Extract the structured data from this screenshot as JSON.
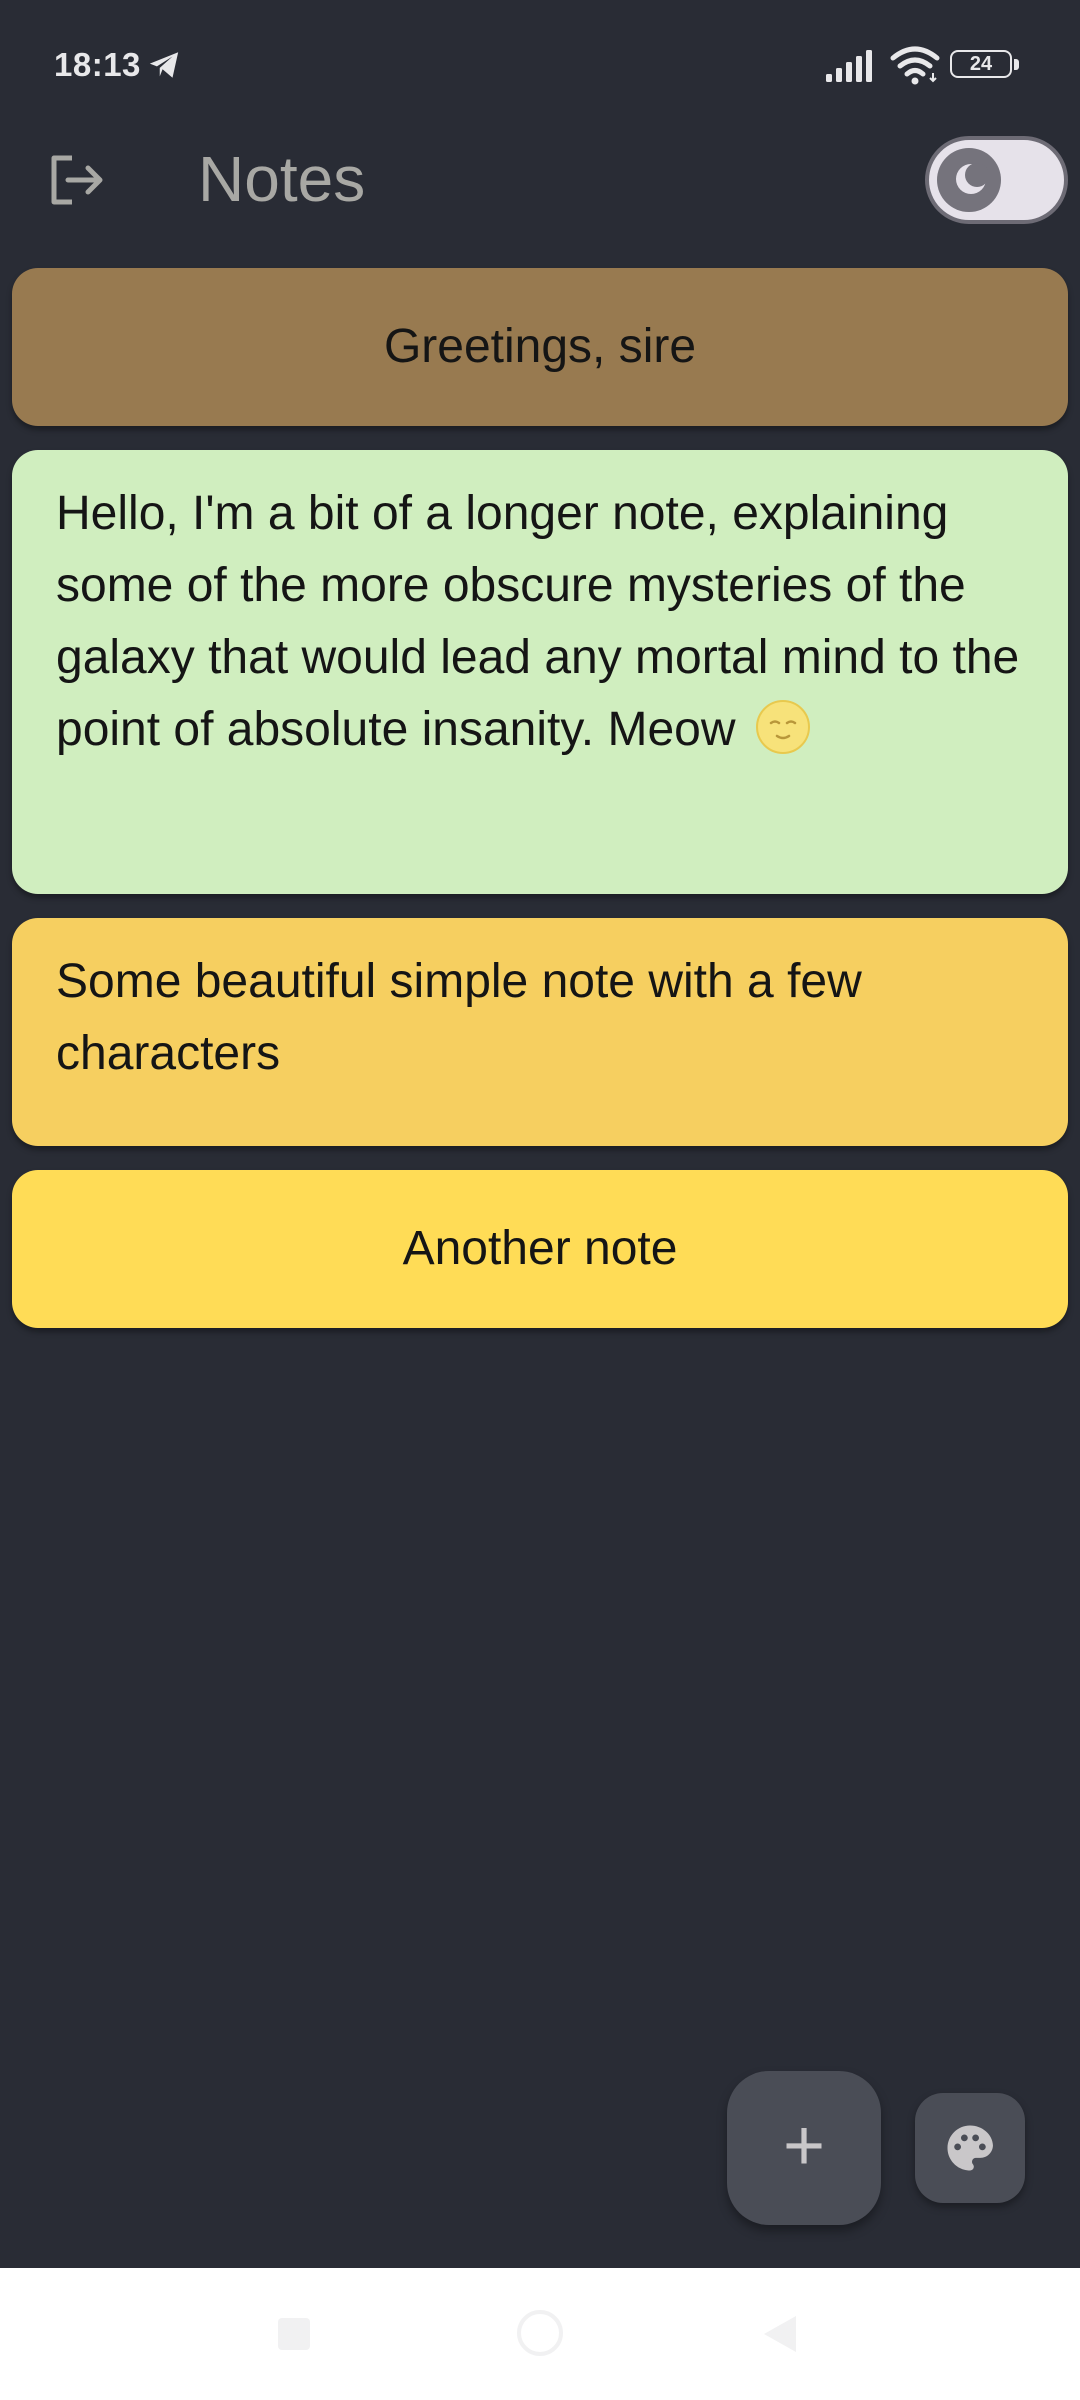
{
  "status_bar": {
    "time": "18:13",
    "battery_level": "24",
    "icons": [
      "telegram-icon",
      "signal-icon",
      "wifi-icon",
      "battery-icon"
    ]
  },
  "app_bar": {
    "title": "Notes",
    "logout_icon": "logout-icon",
    "theme_toggle": {
      "icon": "moon-icon",
      "state": "dark"
    }
  },
  "notes": [
    {
      "text": "Greetings, sire",
      "color": "#987a50",
      "align": "center"
    },
    {
      "text": "Hello, I'm a bit of a longer note, explaining some of the more obscure mysteries of the galaxy that would lead any mortal mind to the point of absolute insanity. Meow",
      "emoji": "🌝",
      "color": "#d0eebf",
      "align": "left"
    },
    {
      "text": "Some beautiful simple note with a few characters",
      "color": "#f6cf60",
      "align": "left"
    },
    {
      "text": "Another note",
      "color": "#ffdc56",
      "align": "center"
    }
  ],
  "fab": {
    "add_label": "+",
    "palette_icon": "palette-icon"
  },
  "colors": {
    "background": "#292c35",
    "fab": "#4a4d56",
    "title": "#a8a8a4"
  }
}
